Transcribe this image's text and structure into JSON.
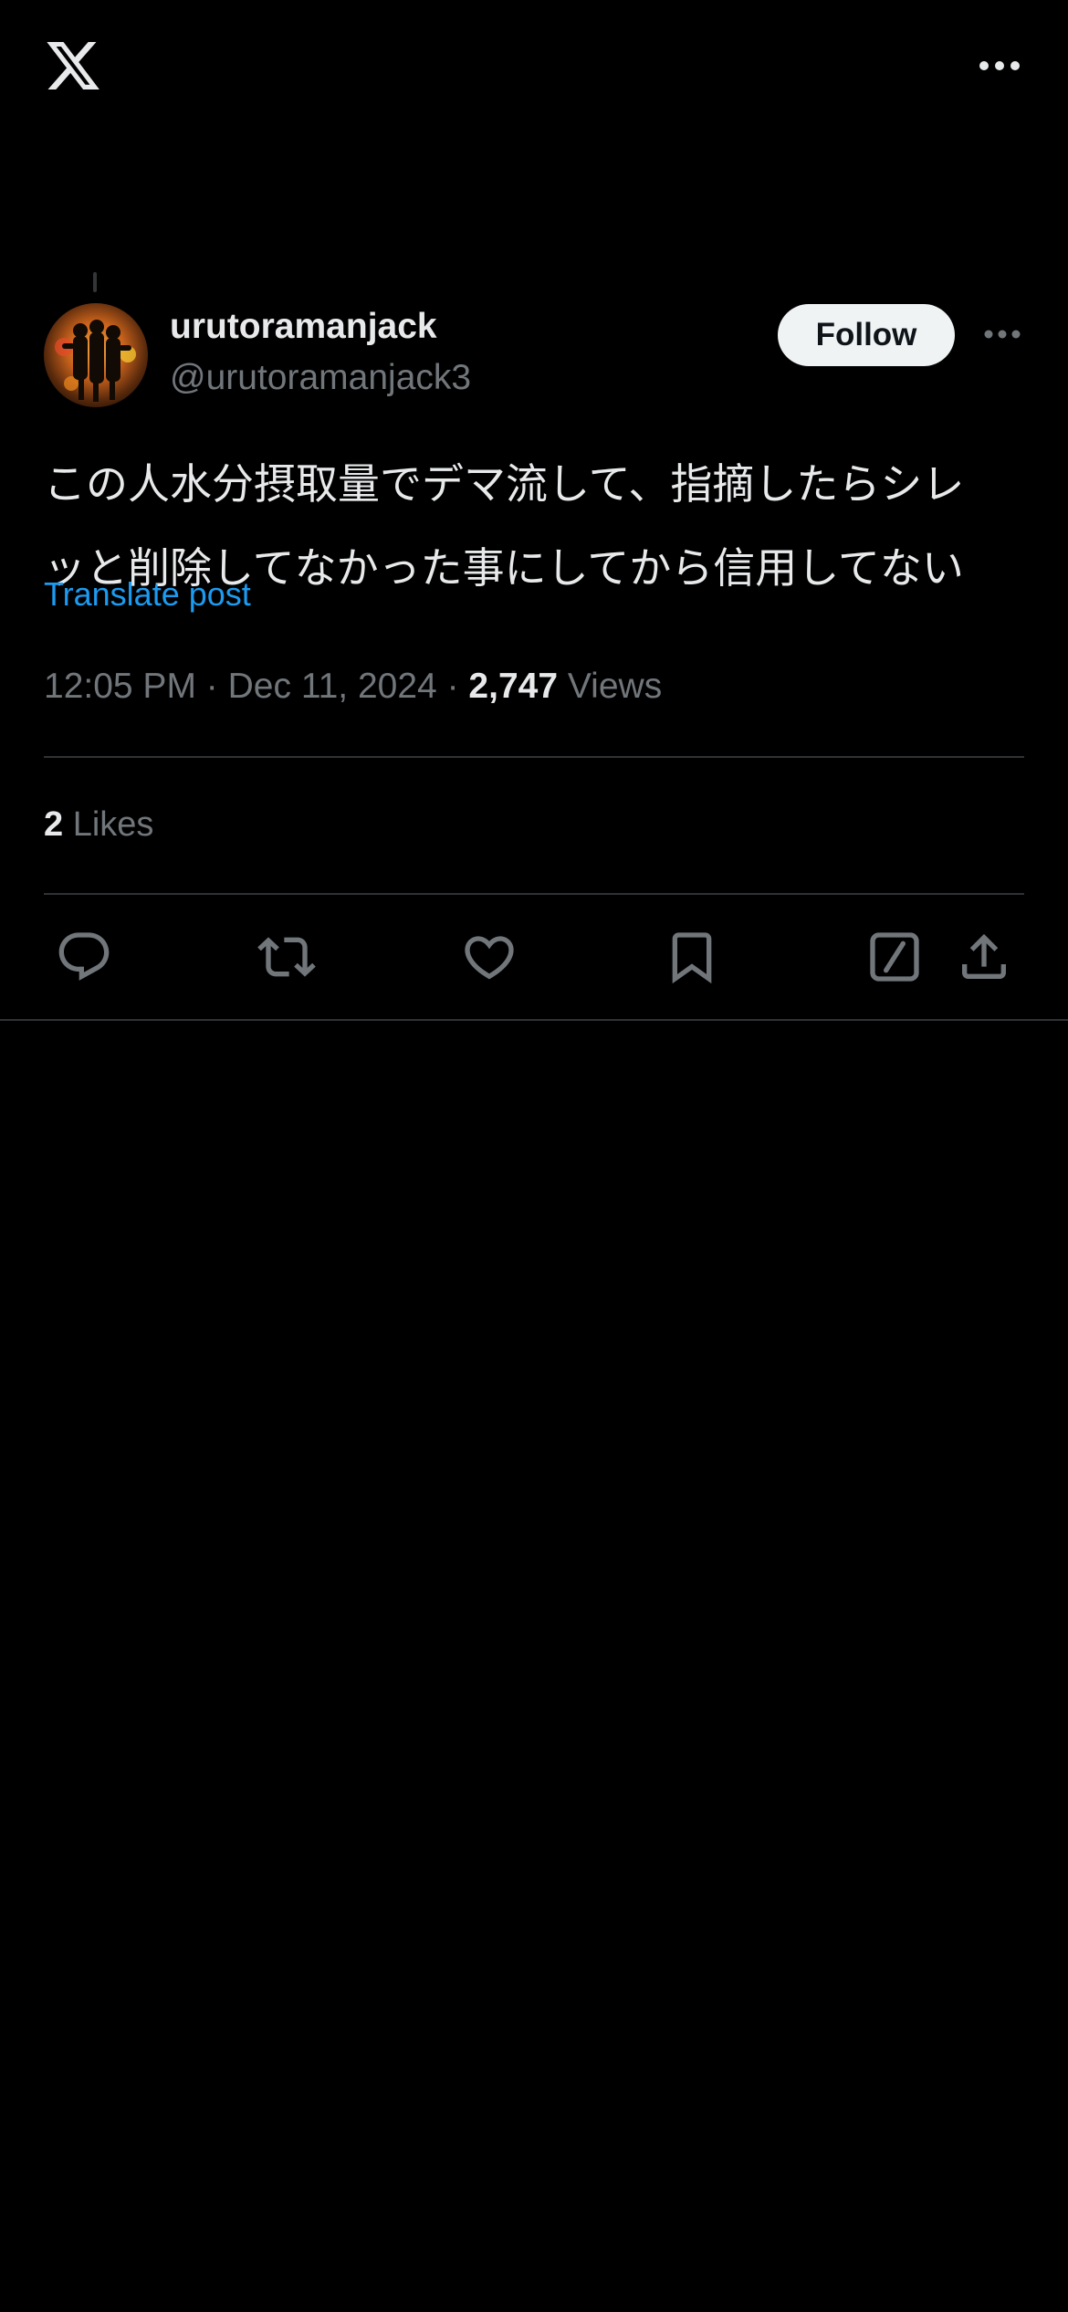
{
  "app": {
    "logo_icon": "x-logo-icon",
    "menu_icon": "more-horizontal-icon"
  },
  "post": {
    "author": {
      "display_name": "urutoramanjack",
      "handle": "@urutoramanjack3"
    },
    "follow_label": "Follow",
    "text": "この人水分摂取量でデマ流して、指摘したらシレ\nッと削除してなかった事にしてから信用してない",
    "translate_label": "Translate post",
    "time": "12:05 PM",
    "date": "Dec 11, 2024",
    "separator": "·",
    "views_count": "2,747",
    "views_label": "Views",
    "likes_count": "2",
    "likes_label": "Likes"
  },
  "actions": [
    {
      "name": "reply",
      "icon": "reply-icon"
    },
    {
      "name": "repost",
      "icon": "repost-icon"
    },
    {
      "name": "like",
      "icon": "heart-icon"
    },
    {
      "name": "bookmark",
      "icon": "bookmark-icon"
    },
    {
      "name": "grok",
      "icon": "grok-icon"
    },
    {
      "name": "share",
      "icon": "share-icon"
    }
  ],
  "colors": {
    "background": "#000000",
    "primary_text": "#e7e9ea",
    "secondary_text": "#71767b",
    "accent": "#1d9bf0",
    "divider": "#2f3336",
    "follow_button_bg": "#eff3f4"
  }
}
